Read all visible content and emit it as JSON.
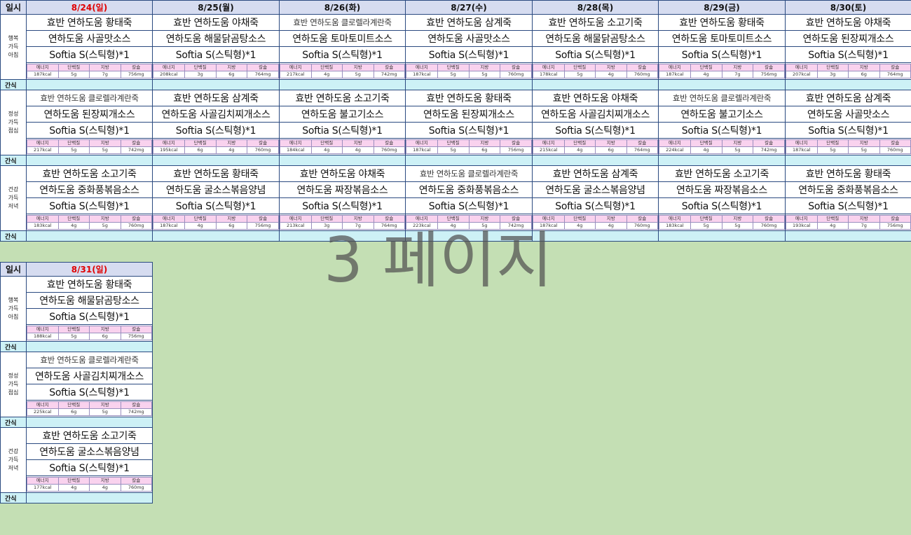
{
  "header_label": "일시",
  "snack_label": "간식",
  "meal_labels": {
    "breakfast": "행복\n가득\n아침",
    "lunch": "정성\n가득\n점심",
    "dinner": "건강\n가득\n저녁"
  },
  "nutrition_headers": [
    "에너지",
    "단백질",
    "지방",
    "칼슘"
  ],
  "days": [
    {
      "date": "8/24(일)",
      "is_sunday": true,
      "breakfast": {
        "items": [
          "효반 연하도움 황태죽",
          "연하도움 사골맛소스",
          "Softia S(스틱형)*1"
        ],
        "nutrition": [
          "187kcal",
          "5g",
          "7g",
          "756mg"
        ]
      },
      "lunch": {
        "items": [
          "효반 연하도움 클로렐라계란죽",
          "연하도움 된장찌개소스",
          "Softia S(스틱형)*1"
        ],
        "nutrition": [
          "217kcal",
          "5g",
          "5g",
          "742mg"
        ]
      },
      "dinner": {
        "items": [
          "효반 연하도움 소고기죽",
          "연하도움 중화풍볶음소스",
          "Softia S(스틱형)*1"
        ],
        "nutrition": [
          "183kcal",
          "4g",
          "5g",
          "760mg"
        ]
      }
    },
    {
      "date": "8/25(월)",
      "is_sunday": false,
      "breakfast": {
        "items": [
          "효반 연하도움 야채죽",
          "연하도움 해물닭곰탕소스",
          "Softia S(스틱형)*1"
        ],
        "nutrition": [
          "208kcal",
          "3g",
          "6g",
          "764mg"
        ]
      },
      "lunch": {
        "items": [
          "효반 연하도움 삼계죽",
          "연하도움 사골김치찌개소스",
          "Softia S(스틱형)*1"
        ],
        "nutrition": [
          "195kcal",
          "6g",
          "4g",
          "760mg"
        ]
      },
      "dinner": {
        "items": [
          "효반 연하도움 황태죽",
          "연하도움 굴소스볶음양념",
          "Softia S(스틱형)*1"
        ],
        "nutrition": [
          "187kcal",
          "4g",
          "6g",
          "756mg"
        ]
      }
    },
    {
      "date": "8/26(화)",
      "is_sunday": false,
      "breakfast": {
        "items": [
          "효반 연하도움 클로렐라계란죽",
          "연하도움 토마토미트소스",
          "Softia S(스틱형)*1"
        ],
        "nutrition": [
          "217kcal",
          "4g",
          "5g",
          "742mg"
        ]
      },
      "lunch": {
        "items": [
          "효반 연하도움 소고기죽",
          "연하도움 불고기소스",
          "Softia S(스틱형)*1"
        ],
        "nutrition": [
          "184kcal",
          "4g",
          "4g",
          "760mg"
        ]
      },
      "dinner": {
        "items": [
          "효반 연하도움 야채죽",
          "연하도움 짜장볶음소스",
          "Softia S(스틱형)*1"
        ],
        "nutrition": [
          "213kcal",
          "3g",
          "7g",
          "764mg"
        ]
      }
    },
    {
      "date": "8/27(수)",
      "is_sunday": false,
      "breakfast": {
        "items": [
          "효반 연하도움 삼계죽",
          "연하도움 사골맛소스",
          "Softia S(스틱형)*1"
        ],
        "nutrition": [
          "187kcal",
          "5g",
          "5g",
          "760mg"
        ]
      },
      "lunch": {
        "items": [
          "효반 연하도움 황태죽",
          "연하도움 된장찌개소스",
          "Softia S(스틱형)*1"
        ],
        "nutrition": [
          "187kcal",
          "5g",
          "6g",
          "756mg"
        ]
      },
      "dinner": {
        "items": [
          "효반 연하도움 클로렐라계란죽",
          "연하도움 중화풍볶음소스",
          "Softia S(스틱형)*1"
        ],
        "nutrition": [
          "223kcal",
          "4g",
          "5g",
          "742mg"
        ]
      }
    },
    {
      "date": "8/28(목)",
      "is_sunday": false,
      "breakfast": {
        "items": [
          "효반 연하도움 소고기죽",
          "연하도움 해물닭곰탕소스",
          "Softia S(스틱형)*1"
        ],
        "nutrition": [
          "178kcal",
          "5g",
          "4g",
          "760mg"
        ]
      },
      "lunch": {
        "items": [
          "효반 연하도움 야채죽",
          "연하도움 사골김치찌개소스",
          "Softia S(스틱형)*1"
        ],
        "nutrition": [
          "215kcal",
          "4g",
          "6g",
          "764mg"
        ]
      },
      "dinner": {
        "items": [
          "효반 연하도움 삼계죽",
          "연하도움 굴소스볶음양념",
          "Softia S(스틱형)*1"
        ],
        "nutrition": [
          "187kcal",
          "4g",
          "4g",
          "760mg"
        ]
      }
    },
    {
      "date": "8/29(금)",
      "is_sunday": false,
      "breakfast": {
        "items": [
          "효반 연하도움 황태죽",
          "연하도움 토마토미트소스",
          "Softia S(스틱형)*1"
        ],
        "nutrition": [
          "187kcal",
          "4g",
          "7g",
          "756mg"
        ]
      },
      "lunch": {
        "items": [
          "효반 연하도움 클로렐라계란죽",
          "연하도움 불고기소스",
          "Softia S(스틱형)*1"
        ],
        "nutrition": [
          "224kcal",
          "4g",
          "5g",
          "742mg"
        ]
      },
      "dinner": {
        "items": [
          "효반 연하도움 소고기죽",
          "연하도움 짜장볶음소스",
          "Softia S(스틱형)*1"
        ],
        "nutrition": [
          "183kcal",
          "5g",
          "5g",
          "760mg"
        ]
      }
    },
    {
      "date": "8/30(토)",
      "is_sunday": false,
      "breakfast": {
        "items": [
          "효반 연하도움 야채죽",
          "연하도움 된장찌개소스",
          "Softia S(스틱형)*1"
        ],
        "nutrition": [
          "207kcal",
          "3g",
          "6g",
          "764mg"
        ]
      },
      "lunch": {
        "items": [
          "효반 연하도움 삼계죽",
          "연하도움 사골맛소스",
          "Softia S(스틱형)*1"
        ],
        "nutrition": [
          "187kcal",
          "5g",
          "5g",
          "760mg"
        ]
      },
      "dinner": {
        "items": [
          "효반 연하도움 황태죽",
          "연하도움 중화풍볶음소스",
          "Softia S(스틱형)*1"
        ],
        "nutrition": [
          "193kcal",
          "4g",
          "7g",
          "756mg"
        ]
      }
    },
    {
      "date": "8/31(일)",
      "is_sunday": true,
      "breakfast": {
        "items": [
          "효반 연하도움 황태죽",
          "연하도움 해물닭곰탕소스",
          "Softia S(스틱형)*1"
        ],
        "nutrition": [
          "188kcal",
          "5g",
          "6g",
          "756mg"
        ]
      },
      "lunch": {
        "items": [
          "효반 연하도움 클로렐라계란죽",
          "연하도움 사골김치찌개소스",
          "Softia S(스틱형)*1"
        ],
        "nutrition": [
          "225kcal",
          "6g",
          "5g",
          "742mg"
        ]
      },
      "dinner": {
        "items": [
          "효반 연하도움 소고기죽",
          "연하도움 굴소스볶음양념",
          "Softia S(스틱형)*1"
        ],
        "nutrition": [
          "177kcal",
          "4g",
          "4g",
          "760mg"
        ]
      }
    }
  ],
  "watermark": "3 페이지",
  "colors": {
    "header_bg": "#d6dcf0",
    "snack_bg": "#cdf1f6",
    "nutrition_header_bg": "#f9d2ee",
    "sunday_text": "#e00000",
    "empty_area": "#c4dfb4",
    "grid_line": "#2b4a80"
  }
}
